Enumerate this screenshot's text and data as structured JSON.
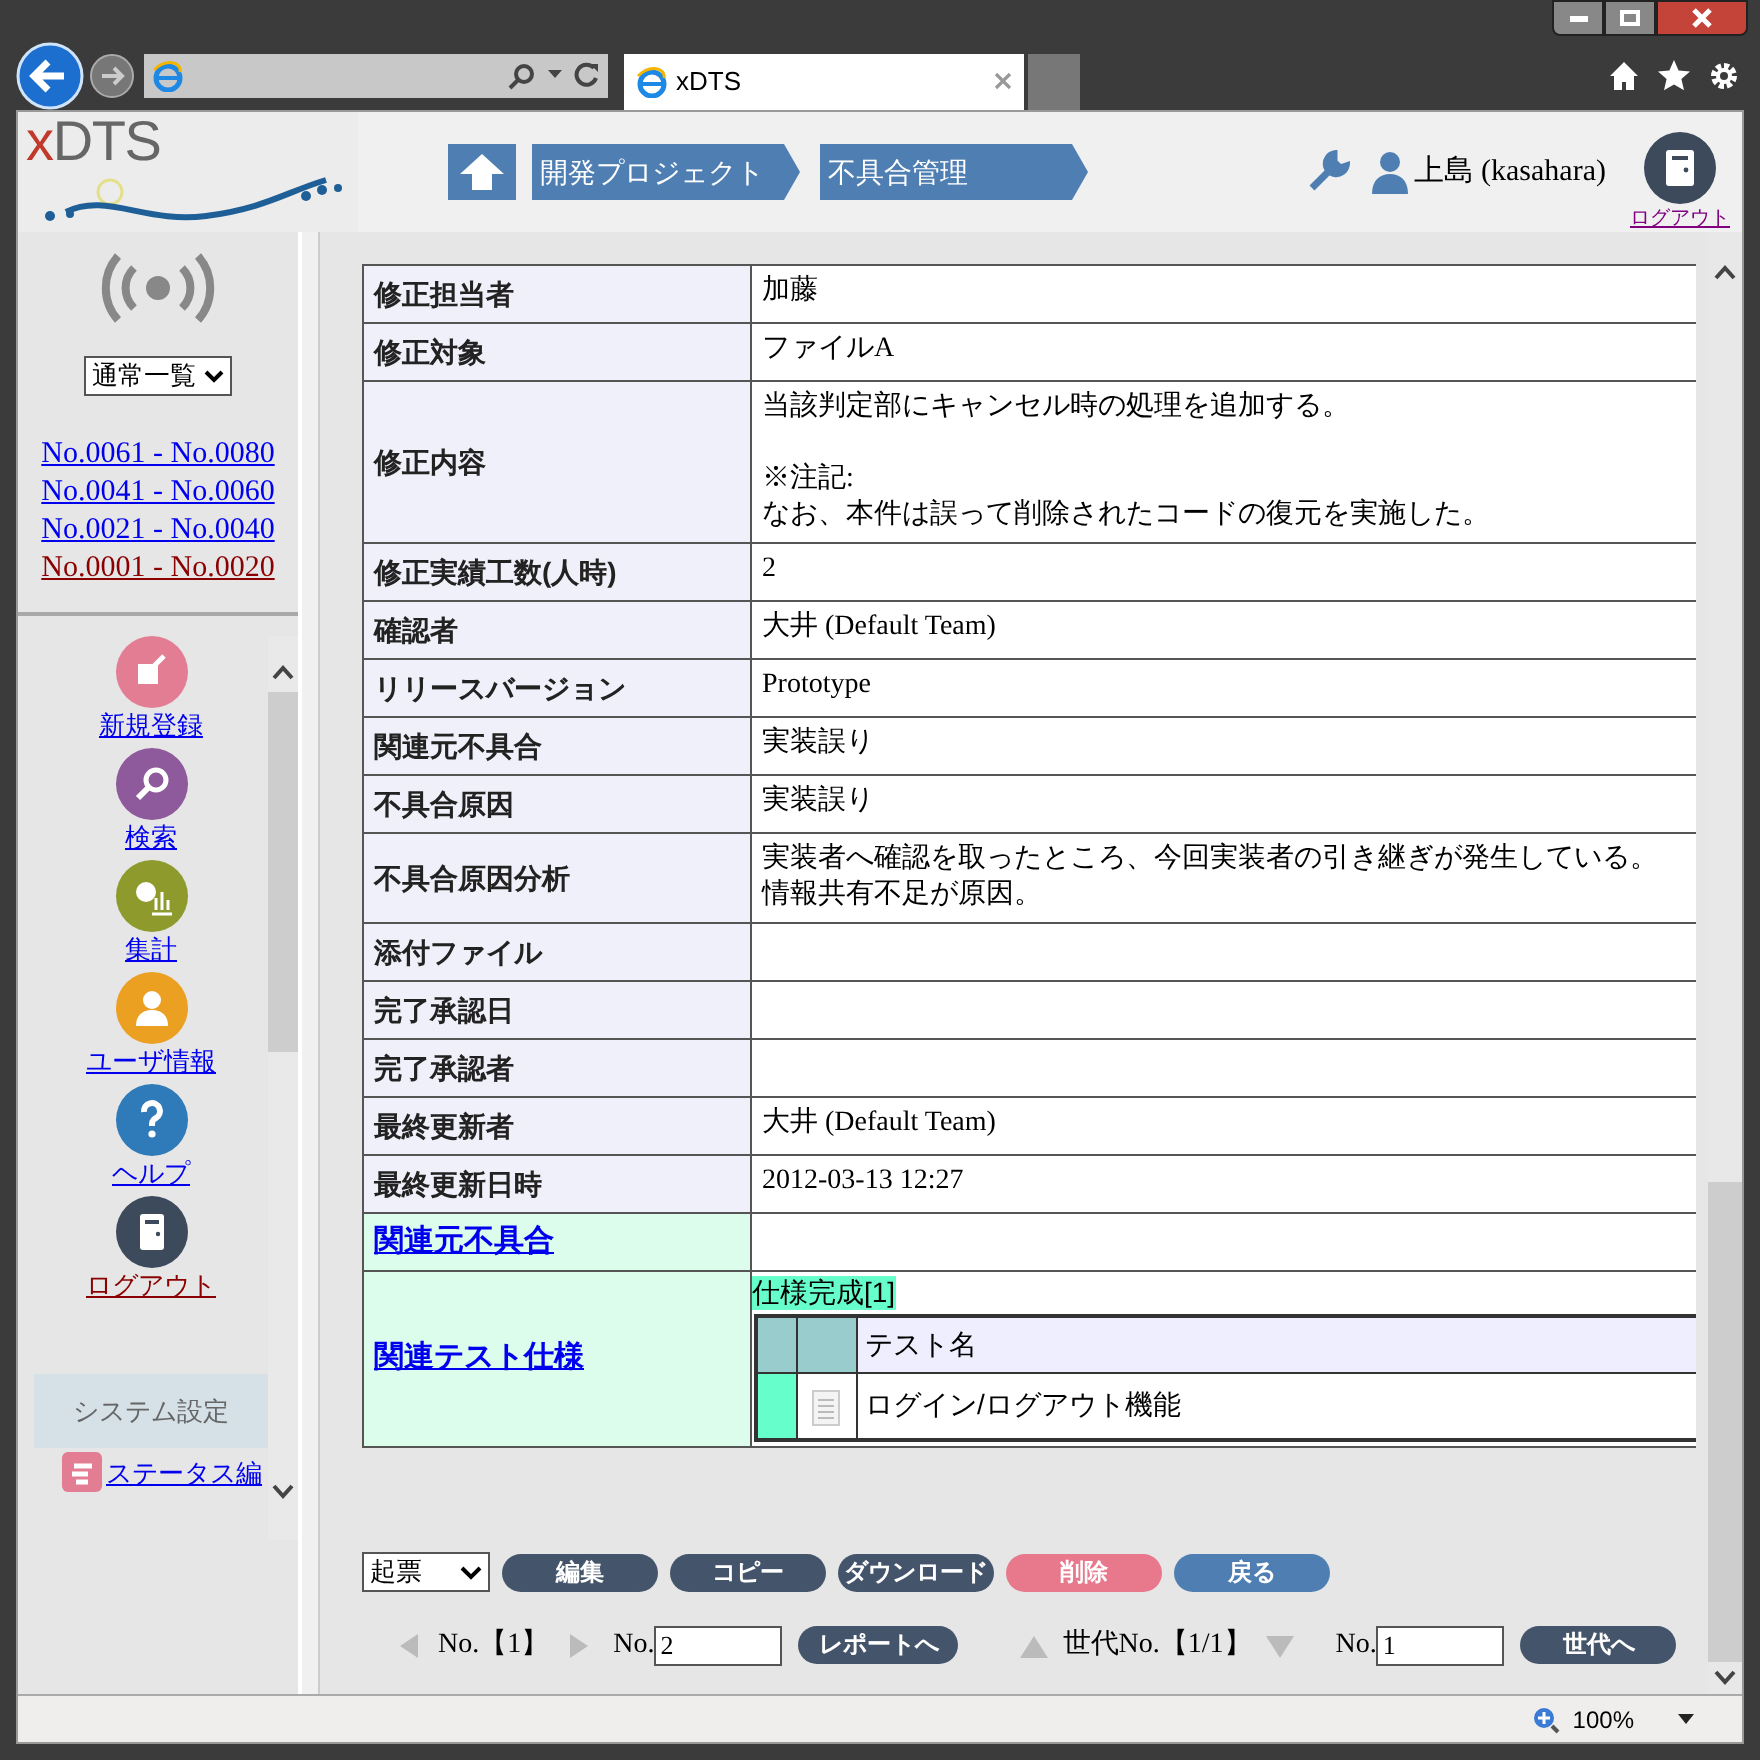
{
  "browser": {
    "tab_title": "xDTS"
  },
  "header": {
    "logo": "xDTS",
    "breadcrumbs": [
      "開発プロジェクト",
      "不具合管理"
    ],
    "user": "上島 (kasahara)",
    "logout": "ログアウト"
  },
  "sidebar": {
    "view_select": "通常一覧",
    "ranges": [
      {
        "label": "No.0061 - No.0080",
        "visited": false
      },
      {
        "label": "No.0041 - No.0060",
        "visited": false
      },
      {
        "label": "No.0021 - No.0040",
        "visited": false
      },
      {
        "label": "No.0001 - No.0020",
        "visited": true
      }
    ],
    "menu": [
      {
        "label": "新規登録",
        "color": "#e27d93",
        "visited": false
      },
      {
        "label": "検索",
        "color": "#8e5a9c",
        "visited": false
      },
      {
        "label": "集計",
        "color": "#8f9a2c",
        "visited": false
      },
      {
        "label": "ユーザ情報",
        "color": "#eba021",
        "visited": false
      },
      {
        "label": "ヘルプ",
        "color": "#2f7ab8",
        "visited": false
      },
      {
        "label": "ログアウト",
        "color": "#3c4a5c",
        "visited": true
      }
    ],
    "settings_title": "システム設定",
    "settings_items": [
      {
        "label": "ステータス編"
      }
    ]
  },
  "record": {
    "rows": [
      {
        "kind": "field",
        "label": "修正担当者",
        "lines": [
          "加藤"
        ]
      },
      {
        "kind": "field",
        "label": "修正対象",
        "lines": [
          "ファイルA"
        ]
      },
      {
        "kind": "field",
        "label": "修正内容",
        "paragraphs": [
          [
            "当該判定部にキャンセル時の処理を追加する。"
          ],
          [
            "※注記:",
            "なお、本件は誤って削除されたコードの復元を実施した。"
          ]
        ]
      },
      {
        "kind": "field",
        "label": "修正実績工数(人時)",
        "lines": [
          "2"
        ]
      },
      {
        "kind": "field",
        "label": "確認者",
        "lines": [
          "大井 (Default Team)"
        ]
      },
      {
        "kind": "field",
        "label": "リリースバージョン",
        "lines": [
          "Prototype"
        ]
      },
      {
        "kind": "field",
        "label": "関連元不具合",
        "lines": [
          "実装誤り"
        ]
      },
      {
        "kind": "field",
        "label": "不具合原因",
        "lines": [
          "実装誤り"
        ]
      },
      {
        "kind": "field",
        "label": "不具合原因分析",
        "lines": [
          "実装者へ確認を取ったところ、今回実装者の引き継ぎが発生している。",
          "情報共有不足が原因。"
        ]
      },
      {
        "kind": "field",
        "label": "添付ファイル"
      },
      {
        "kind": "field",
        "label": "完了承認日"
      },
      {
        "kind": "field",
        "label": "完了承認者"
      },
      {
        "kind": "field",
        "label": "最終更新者",
        "lines": [
          "大井 (Default Team)"
        ]
      },
      {
        "kind": "field",
        "label": "最終更新日時",
        "lines": [
          "2012-03-13 12:27"
        ]
      },
      {
        "kind": "link",
        "label": "関連元不具合"
      },
      {
        "kind": "tests",
        "label": "関連テスト仕様",
        "status": "仕様完成[1]",
        "column": "テスト名",
        "tests": [
          {
            "name": "ログイン/ログアウト機能"
          }
        ]
      }
    ]
  },
  "actions": {
    "status_select": "起票",
    "buttons": [
      {
        "label": "編集",
        "color": "#44546a"
      },
      {
        "label": "コピー",
        "color": "#44546a"
      },
      {
        "label": "ダウンロード",
        "color": "#44546a"
      },
      {
        "label": "削除",
        "color": "#e8788c"
      },
      {
        "label": "戻る",
        "color": "#4f7fb2"
      }
    ]
  },
  "pager": {
    "report_no": "No.【1】",
    "no_label": "No.",
    "report_input": "2",
    "report_button": "レポートへ",
    "generation": "世代No.【1/1】",
    "gen_no_label": "No.",
    "gen_input": "1",
    "gen_button": "世代へ"
  },
  "status_bar": {
    "zoom": "100%"
  }
}
